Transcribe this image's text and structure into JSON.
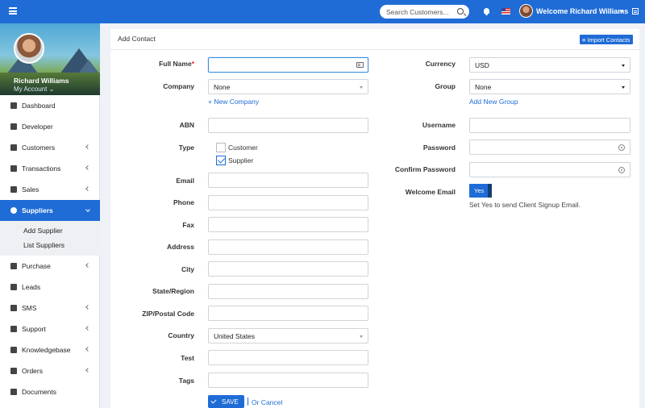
{
  "topbar": {
    "search_placeholder": "Search Customers...",
    "welcome": "Welcome Richard Williams"
  },
  "profile": {
    "name": "Richard Williams",
    "account": "My Account ⌄"
  },
  "sidebar": {
    "items": [
      {
        "label": "Dashboard",
        "icon": "dashboard-icon"
      },
      {
        "label": "Developer",
        "icon": "document-icon"
      },
      {
        "label": "Customers",
        "icon": "users-icon"
      },
      {
        "label": "Transactions",
        "icon": "calculator-icon"
      },
      {
        "label": "Sales",
        "icon": "cart-icon"
      },
      {
        "label": "Suppliers",
        "icon": "globe-icon"
      },
      {
        "label": "Purchase",
        "icon": "truck-icon"
      },
      {
        "label": "Leads",
        "icon": "list-icon"
      },
      {
        "label": "SMS",
        "icon": "chat-icon"
      },
      {
        "label": "Support",
        "icon": "lifebuoy-icon"
      },
      {
        "label": "Knowledgebase",
        "icon": "book-icon"
      },
      {
        "label": "Orders",
        "icon": "list-icon"
      },
      {
        "label": "Documents",
        "icon": "file-icon"
      }
    ],
    "sub_items": [
      "Add Supplier",
      "List Suppliers"
    ]
  },
  "panel": {
    "title": "Add Contact",
    "import_label": "≡ Import Contacts"
  },
  "form_left": {
    "full_name": "Full Name",
    "company": "Company",
    "company_value": "None",
    "new_company": "+ New Company",
    "abn": "ABN",
    "type": "Type",
    "type_customer": "Customer",
    "type_supplier": "Supplier",
    "email": "Email",
    "phone": "Phone",
    "fax": "Fax",
    "address": "Address",
    "city": "City",
    "state": "State/Region",
    "zip": "ZIP/Postal Code",
    "country": "Country",
    "country_value": "United States",
    "test": "Test",
    "tags": "Tags",
    "save": "SAVE",
    "or_cancel": "Or Cancel"
  },
  "form_right": {
    "currency": "Currency",
    "currency_value": "USD",
    "group": "Group",
    "group_value": "None",
    "add_group": "Add New Group",
    "username": "Username",
    "password": "Password",
    "confirm_password": "Confirm Password",
    "welcome_email": "Welcome Email",
    "toggle_value": "Yes",
    "hint": "Set Yes to send Client Signup Email."
  },
  "colors": {
    "accent": "#1f6cd6",
    "required": "#e02020"
  }
}
